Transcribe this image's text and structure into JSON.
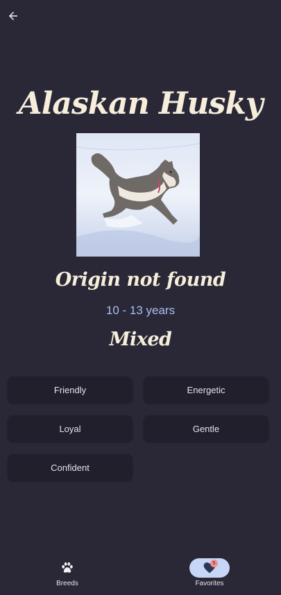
{
  "breed": {
    "name": "Alaskan Husky",
    "origin": "Origin not found",
    "lifespan": "10 - 13 years",
    "type": "Mixed",
    "photo_description": "husky-running-in-snow"
  },
  "temperament": [
    "Friendly",
    "Energetic",
    "Loyal",
    "Gentle",
    "Confident"
  ],
  "nav": {
    "breeds_label": "Breeds",
    "favorites_label": "Favorites",
    "favorites_count": "5",
    "active": "favorites"
  },
  "colors": {
    "background": "#2a2837",
    "chip": "#201f2b",
    "title": "#f6eedb",
    "lifespan": "#a9bff0",
    "nav_active_pill": "#c7d5f7",
    "badge": "#f08f8f"
  },
  "icons": {
    "back": "arrow-left-icon",
    "breeds": "paw-icon",
    "favorites": "heart-icon"
  }
}
